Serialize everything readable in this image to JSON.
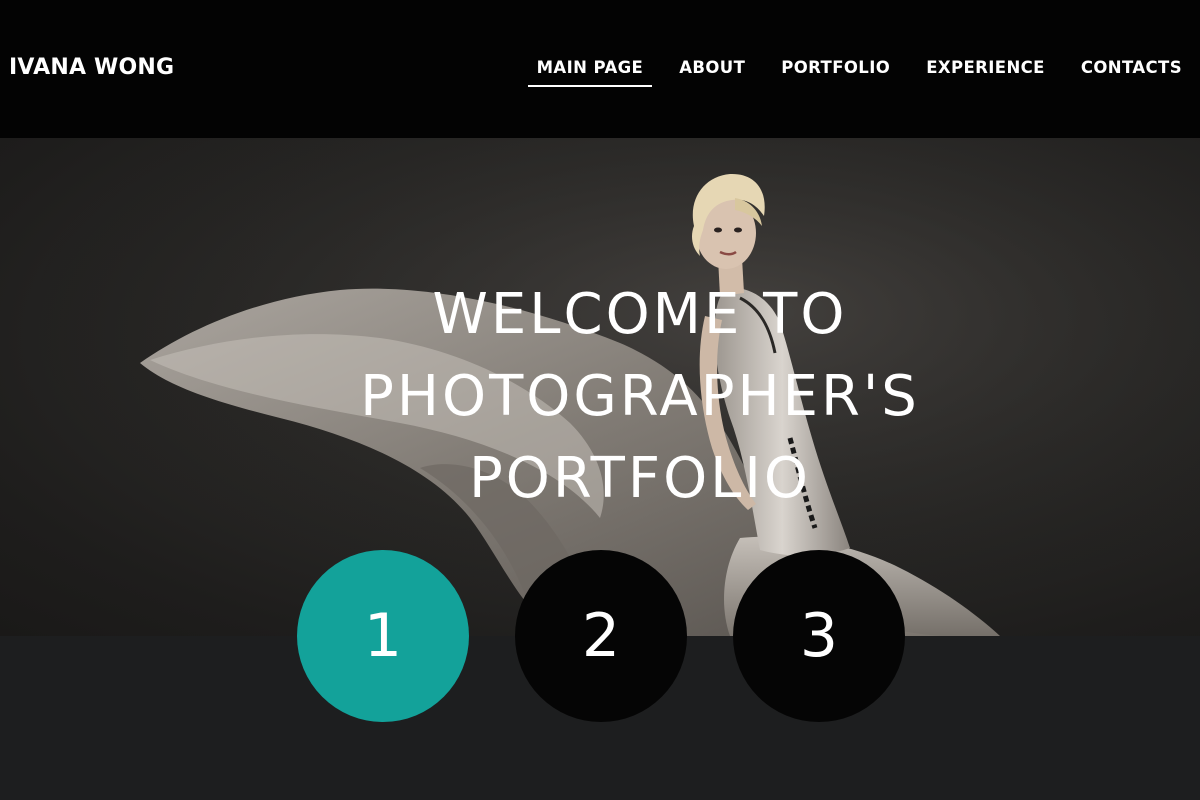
{
  "header": {
    "brand": "IVANA WONG",
    "nav": [
      {
        "label": "MAIN PAGE",
        "active": true
      },
      {
        "label": "ABOUT",
        "active": false
      },
      {
        "label": "PORTFOLIO",
        "active": false
      },
      {
        "label": "EXPERIENCE",
        "active": false
      },
      {
        "label": "CONTACTS",
        "active": false
      }
    ]
  },
  "hero": {
    "title_lines": [
      "WELCOME TO",
      "PHOTOGRAPHER'S",
      "PORTFOLIO"
    ]
  },
  "pager": {
    "items": [
      {
        "label": "1",
        "active": true
      },
      {
        "label": "2",
        "active": false
      },
      {
        "label": "3",
        "active": false
      }
    ]
  },
  "colors": {
    "header_bg": "#030303",
    "accent": "#13a29a",
    "footer_bg": "#1d1e1f"
  }
}
